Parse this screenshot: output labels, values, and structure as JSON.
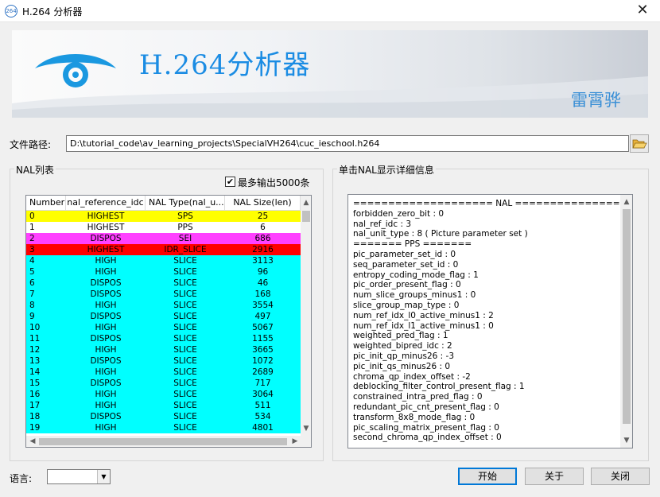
{
  "window": {
    "title": "H.264 分析器",
    "icon_text": "264",
    "close_glyph": "✕"
  },
  "banner": {
    "title": "H.264分析器",
    "author": "雷霄骅"
  },
  "file": {
    "label": "文件路径:",
    "path": "D:\\tutorial_code\\av_learning_projects\\SpecialVH264\\cuc_ieschool.h264"
  },
  "nal_list": {
    "group_title": "NAL列表",
    "max_output_label": "最多输出5000条",
    "max_output_checked": true,
    "check_glyph": "✔",
    "columns": [
      "Number",
      "nal_reference_idc",
      "NAL Type(nal_u...",
      "NAL Size(len)"
    ],
    "rows": [
      {
        "number": "0",
        "ref_idc": "HIGHEST",
        "type": "SPS",
        "size": "25",
        "color": "#ffff00"
      },
      {
        "number": "1",
        "ref_idc": "HIGHEST",
        "type": "PPS",
        "size": "6",
        "color": "#ffffff"
      },
      {
        "number": "2",
        "ref_idc": "DISPOS",
        "type": "SEI",
        "size": "686",
        "color": "#ff40ff"
      },
      {
        "number": "3",
        "ref_idc": "HIGHEST",
        "type": "IDR_SLICE",
        "size": "2916",
        "color": "#ff0000"
      },
      {
        "number": "4",
        "ref_idc": "HIGH",
        "type": "SLICE",
        "size": "3113",
        "color": "#00ffff"
      },
      {
        "number": "5",
        "ref_idc": "HIGH",
        "type": "SLICE",
        "size": "96",
        "color": "#00ffff"
      },
      {
        "number": "6",
        "ref_idc": "DISPOS",
        "type": "SLICE",
        "size": "46",
        "color": "#00ffff"
      },
      {
        "number": "7",
        "ref_idc": "DISPOS",
        "type": "SLICE",
        "size": "168",
        "color": "#00ffff"
      },
      {
        "number": "8",
        "ref_idc": "HIGH",
        "type": "SLICE",
        "size": "3554",
        "color": "#00ffff"
      },
      {
        "number": "9",
        "ref_idc": "DISPOS",
        "type": "SLICE",
        "size": "497",
        "color": "#00ffff"
      },
      {
        "number": "10",
        "ref_idc": "HIGH",
        "type": "SLICE",
        "size": "5067",
        "color": "#00ffff"
      },
      {
        "number": "11",
        "ref_idc": "DISPOS",
        "type": "SLICE",
        "size": "1155",
        "color": "#00ffff"
      },
      {
        "number": "12",
        "ref_idc": "HIGH",
        "type": "SLICE",
        "size": "3665",
        "color": "#00ffff"
      },
      {
        "number": "13",
        "ref_idc": "DISPOS",
        "type": "SLICE",
        "size": "1072",
        "color": "#00ffff"
      },
      {
        "number": "14",
        "ref_idc": "HIGH",
        "type": "SLICE",
        "size": "2689",
        "color": "#00ffff"
      },
      {
        "number": "15",
        "ref_idc": "DISPOS",
        "type": "SLICE",
        "size": "717",
        "color": "#00ffff"
      },
      {
        "number": "16",
        "ref_idc": "HIGH",
        "type": "SLICE",
        "size": "3064",
        "color": "#00ffff"
      },
      {
        "number": "17",
        "ref_idc": "HIGH",
        "type": "SLICE",
        "size": "511",
        "color": "#00ffff"
      },
      {
        "number": "18",
        "ref_idc": "DISPOS",
        "type": "SLICE",
        "size": "534",
        "color": "#00ffff"
      },
      {
        "number": "19",
        "ref_idc": "HIGH",
        "type": "SLICE",
        "size": "4801",
        "color": "#00ffff"
      }
    ]
  },
  "detail": {
    "group_title": "单击NAL显示详细信息",
    "lines": [
      "==================== NAL ====================",
      "forbidden_zero_bit : 0",
      "nal_ref_idc : 3",
      "nal_unit_type : 8 ( Picture parameter set )",
      "======= PPS =======",
      "pic_parameter_set_id : 0",
      "seq_parameter_set_id : 0",
      "entropy_coding_mode_flag : 1",
      "pic_order_present_flag : 0",
      "num_slice_groups_minus1 : 0",
      "slice_group_map_type : 0",
      "num_ref_idx_l0_active_minus1 : 2",
      "num_ref_idx_l1_active_minus1 : 0",
      "weighted_pred_flag : 1",
      "weighted_bipred_idc : 2",
      "pic_init_qp_minus26 : -3",
      "pic_init_qs_minus26 : 0",
      "chroma_qp_index_offset : -2",
      "deblocking_filter_control_present_flag : 1",
      "constrained_intra_pred_flag : 0",
      "redundant_pic_cnt_present_flag : 0",
      "transform_8x8_mode_flag : 0",
      "pic_scaling_matrix_present_flag : 0",
      "second_chroma_qp_index_offset : 0"
    ]
  },
  "bottom": {
    "language_label": "语言:",
    "language_value": "",
    "start_label": "开始",
    "about_label": "关于",
    "close_label": "关闭"
  },
  "icons": {
    "folder": "folder-open-icon",
    "eye": "eye-logo-icon",
    "dropdown": "chevron-down-icon"
  },
  "colors": {
    "banner_title": "#1b8ce3",
    "banner_author": "#3a8fd6"
  }
}
